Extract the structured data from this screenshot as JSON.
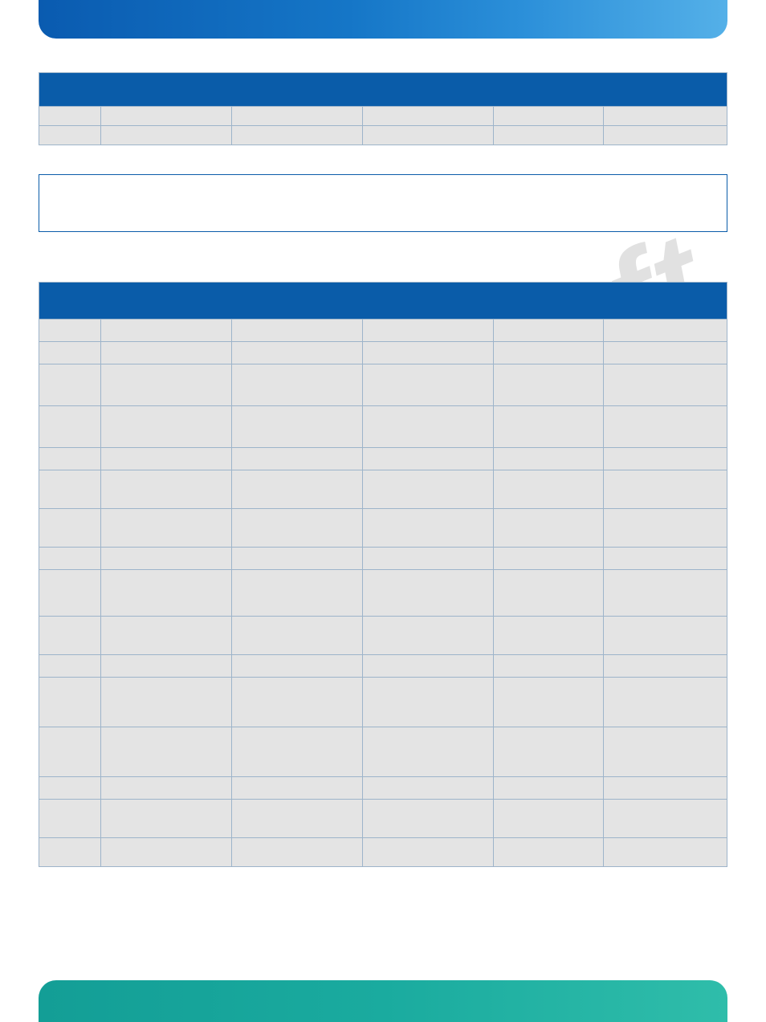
{
  "watermark": "Draft",
  "table1": {
    "columns": [
      "",
      "",
      "",
      "",
      "",
      ""
    ],
    "rows": [
      [
        "",
        "",
        "",
        "",
        "",
        ""
      ],
      [
        "",
        "",
        "",
        "",
        "",
        ""
      ]
    ]
  },
  "callout_text": "",
  "table2": {
    "columns": [
      "",
      "",
      "",
      "",
      "",
      ""
    ],
    "rows": [
      [
        "",
        "",
        "",
        "",
        "",
        ""
      ],
      [
        "",
        "",
        "",
        "",
        "",
        ""
      ],
      [
        "",
        "",
        "",
        "",
        "",
        ""
      ],
      [
        "",
        "",
        "",
        "",
        "",
        ""
      ],
      [
        "",
        "",
        "",
        "",
        "",
        ""
      ],
      [
        "",
        "",
        "",
        "",
        "",
        ""
      ],
      [
        "",
        "",
        "",
        "",
        "",
        ""
      ],
      [
        "",
        "",
        "",
        "",
        "",
        ""
      ],
      [
        "",
        "",
        "",
        "",
        "",
        ""
      ],
      [
        "",
        "",
        "",
        "",
        "",
        ""
      ],
      [
        "",
        "",
        "",
        "",
        "",
        ""
      ],
      [
        "",
        "",
        "",
        "",
        "",
        ""
      ],
      [
        "",
        "",
        "",
        "",
        "",
        ""
      ],
      [
        "",
        "",
        "",
        "",
        "",
        ""
      ],
      [
        "",
        "",
        "",
        "",
        "",
        ""
      ],
      [
        "",
        "",
        "",
        "",
        "",
        ""
      ]
    ],
    "row_heights": [
      "h28",
      "h28",
      "h52",
      "h52",
      "h28",
      "h48",
      "h48",
      "h28",
      "h58",
      "h48",
      "h28",
      "h62",
      "h62",
      "h28",
      "h48",
      "h36"
    ]
  }
}
